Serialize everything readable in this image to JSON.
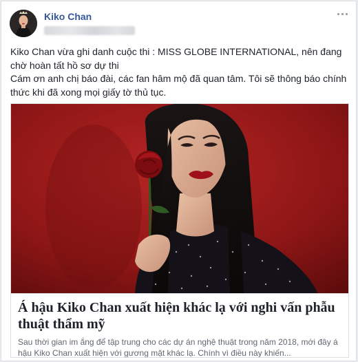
{
  "post": {
    "author": "Kiko Chan",
    "avatar": "avatar",
    "more_icon": "more-options-icon",
    "text_lines": [
      "Kiko Chan vừa ghi danh cuộc thi : MISS GLOBE INTERNATIONAL, nên đang chờ hoàn tất hồ sơ dự thi",
      "Cám ơn anh chị báo đài, các fan hâm mộ đã quan tâm. Tôi sẽ thông báo chính thức khi đã xong mọi giấy tờ thủ tục."
    ]
  },
  "link_card": {
    "title": "Á hậu Kiko Chan xuất hiện khác lạ với nghi vấn phẫu thuật thẩm mỹ",
    "description": "Sau thời gian im ắng để tập trung cho các dự án nghệ thuật trong năm 2018, mới đây á hậu Kiko Chan xuất hiện với gương mặt khác lạ. Chính vì điều này khiến..."
  },
  "colors": {
    "author_link": "#365899",
    "text": "#1d2129",
    "secondary_text": "#606770",
    "border": "#dddfe2",
    "image_background": "#9a1818"
  }
}
